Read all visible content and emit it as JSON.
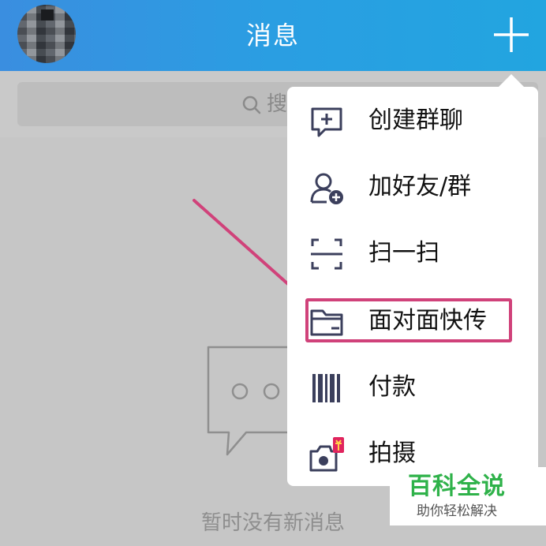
{
  "header": {
    "title": "消息",
    "background": "#2a9ee2"
  },
  "search": {
    "placeholder": "搜"
  },
  "empty_state": {
    "text": "暂时没有新消息"
  },
  "menu": {
    "items": [
      {
        "label": "创建群聊",
        "icon": "chat-plus-icon"
      },
      {
        "label": "加好友/群",
        "icon": "add-friend-icon"
      },
      {
        "label": "扫一扫",
        "icon": "scan-icon"
      },
      {
        "label": "面对面快传",
        "icon": "folder-icon"
      },
      {
        "label": "付款",
        "icon": "barcode-icon"
      },
      {
        "label": "拍摄",
        "icon": "camera-icon"
      }
    ],
    "highlighted_item": "面对面快传",
    "highlight_color": "#d0427a"
  },
  "watermark": {
    "title": "百科全说",
    "subtitle": "助你轻松解决",
    "title_color": "#2fb24a"
  }
}
